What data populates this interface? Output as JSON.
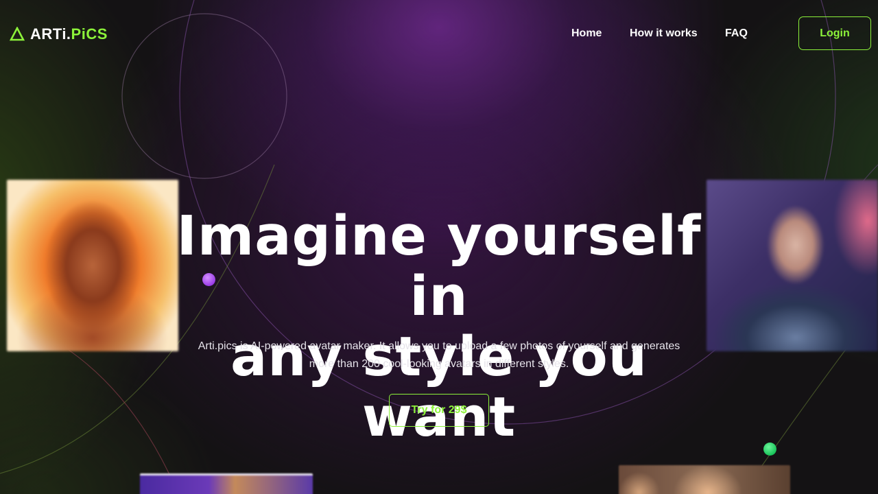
{
  "brand": {
    "name_part1": "ARTi.",
    "name_part2": "PiCS",
    "accent_color": "#8cf23a",
    "logo_icon": "triangle-logo-icon"
  },
  "nav": {
    "items": [
      {
        "label": "Home"
      },
      {
        "label": "How it works"
      },
      {
        "label": "FAQ"
      }
    ],
    "login_label": "Login"
  },
  "hero": {
    "title_line1": "Imagine yourself in",
    "title_line2": "any style you want",
    "subtitle_line1": "Arti.pics is AI-powered avatar maker. It allows you to upload a few photos of yourself and generates",
    "subtitle_line2": "more than 200 cool-looking avatars in different styles.",
    "cta_label": "Try for 29$"
  },
  "images": [
    {
      "name": "avatar-fire-woman"
    },
    {
      "name": "avatar-sci-fi-man"
    },
    {
      "name": "avatar-bottom-left"
    },
    {
      "name": "avatar-bottom-right"
    }
  ]
}
